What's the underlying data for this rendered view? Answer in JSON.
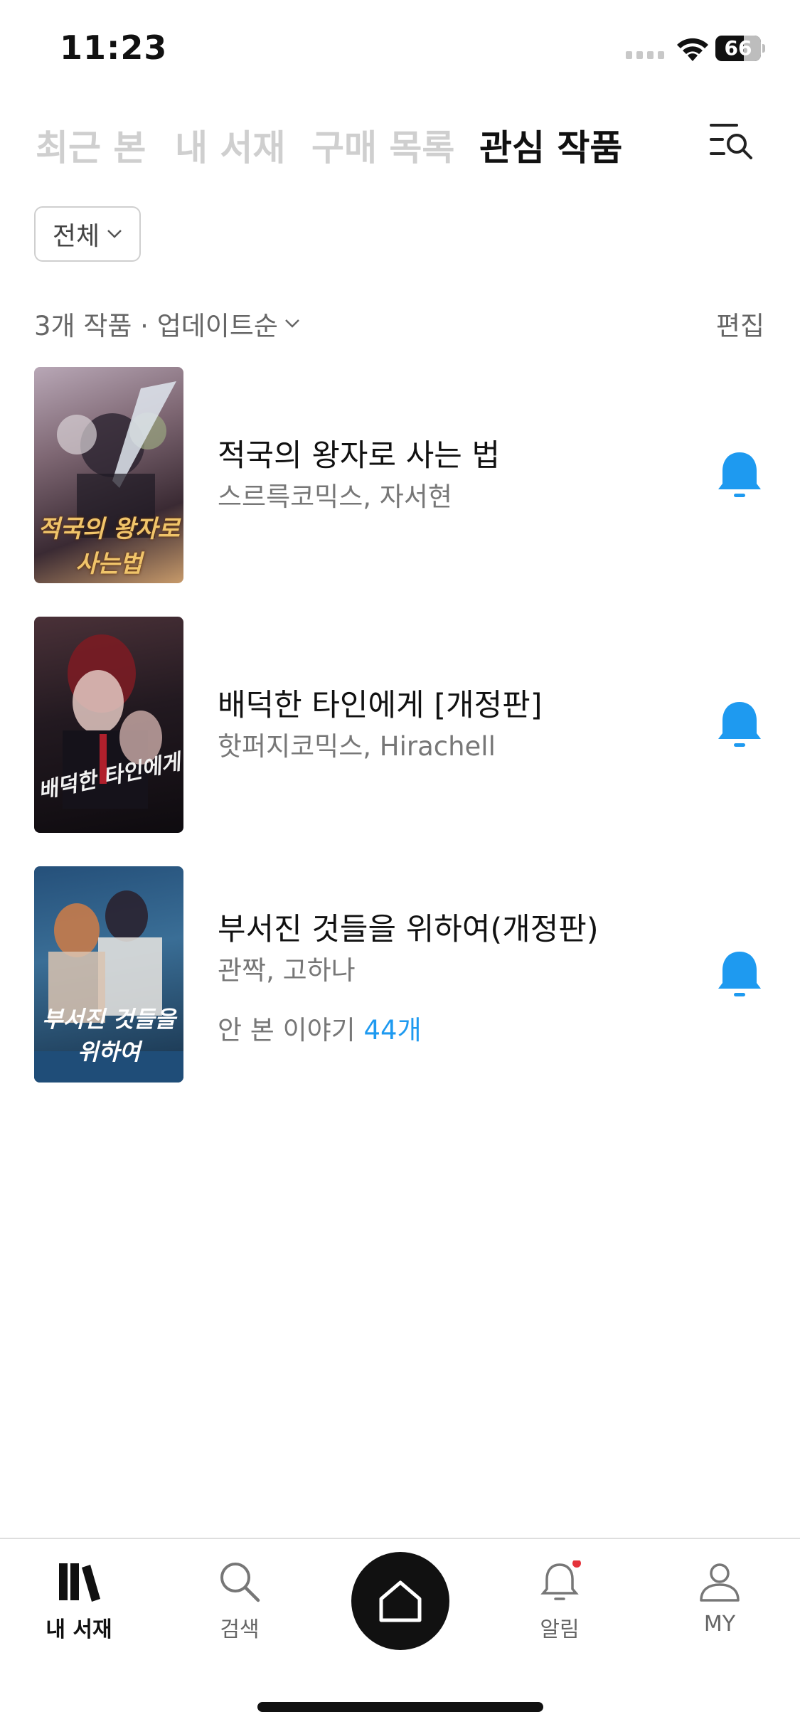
{
  "status_bar": {
    "time": "11:23",
    "battery": "66"
  },
  "tabs": [
    {
      "label": "최근 본",
      "active": false
    },
    {
      "label": "내 서재",
      "active": false
    },
    {
      "label": "구매 목록",
      "active": false
    },
    {
      "label": "관심 작품",
      "active": true
    }
  ],
  "filter": {
    "selected": "전체"
  },
  "list_header": {
    "summary": "3개 작품 · 업데이트순",
    "edit_label": "편집"
  },
  "items": [
    {
      "title": "적국의 왕자로 사는 법",
      "author": "스르륵코믹스, 자서현",
      "cover_text": "적국의 왕자로 사는법",
      "cover_colors": [
        "#b08a7c",
        "#4e3b45"
      ]
    },
    {
      "title": "배덕한 타인에게 [개정판]",
      "author": "핫퍼지코믹스, Hirachell",
      "cover_text": "배덕한 타인에게",
      "cover_colors": [
        "#3a2630",
        "#120d12"
      ]
    },
    {
      "title": "부서진 것들을 위하여(개정판)",
      "author": "관짝, 고하나",
      "unread_prefix": "안 본 이야기 ",
      "unread_count": "44개",
      "cover_text": "부서진 것들을 위하여",
      "cover_colors": [
        "#2f5f8a",
        "#0f2238"
      ]
    }
  ],
  "bottom_nav": [
    {
      "label": "내 서재",
      "icon": "library-icon",
      "active": true
    },
    {
      "label": "검색",
      "icon": "search-icon",
      "active": false
    },
    {
      "label": "",
      "icon": "home-icon",
      "active": false
    },
    {
      "label": "알림",
      "icon": "bell-icon",
      "active": false
    },
    {
      "label": "MY",
      "icon": "profile-icon",
      "active": false
    }
  ],
  "colors": {
    "accent": "#1e9af0",
    "notification_dot": "#e5333b"
  }
}
